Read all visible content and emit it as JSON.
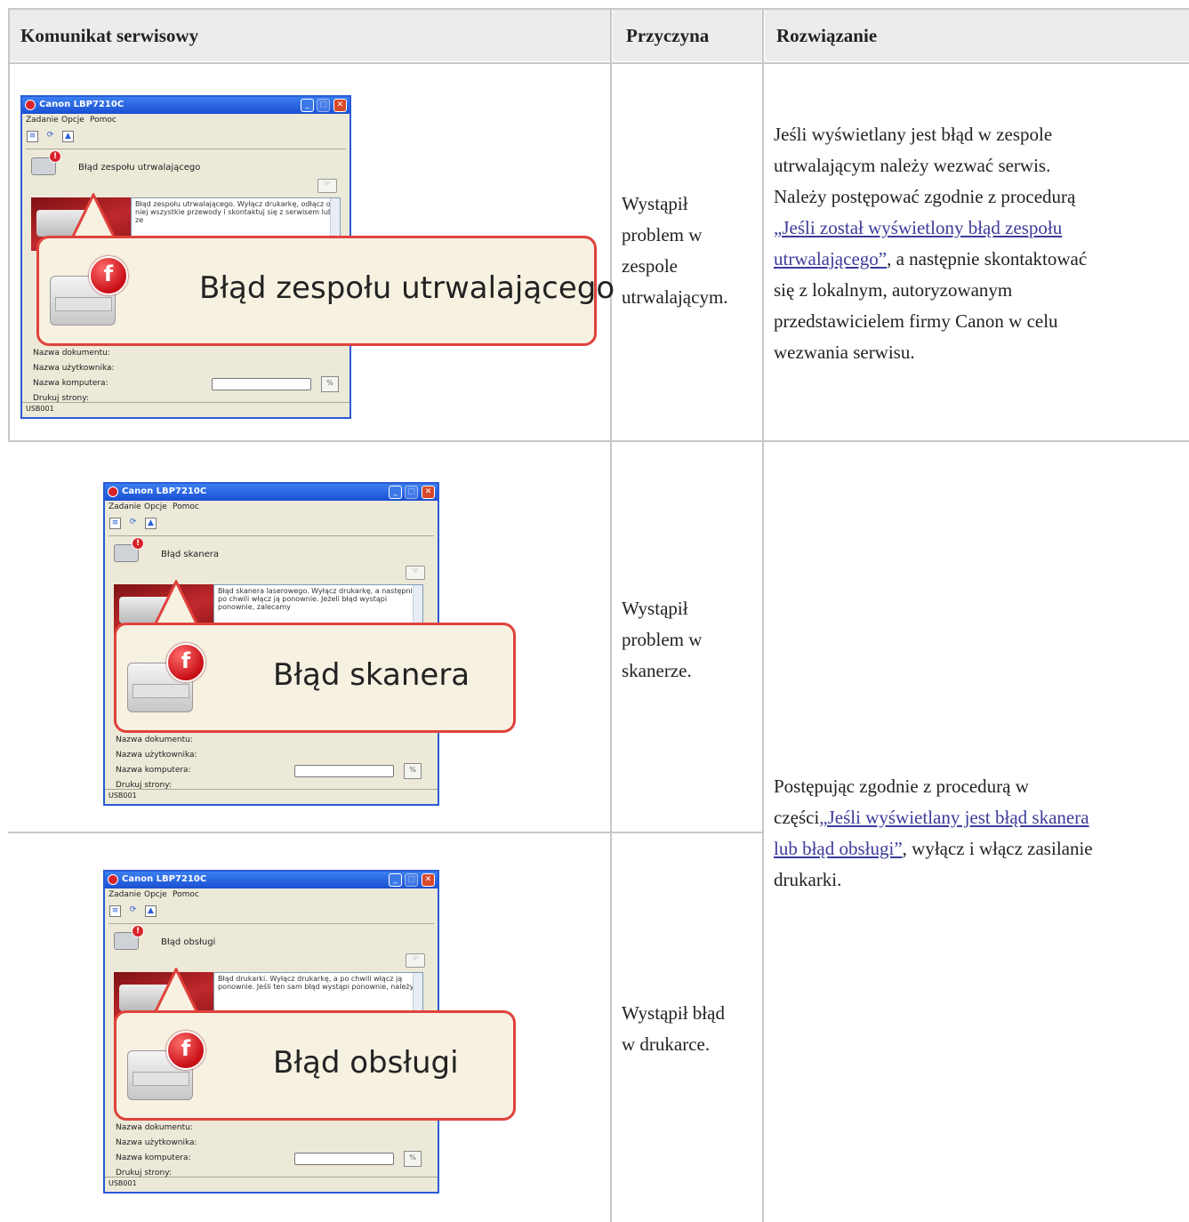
{
  "headers": {
    "message": "Komunikat serwisowy",
    "cause": "Przyczyna",
    "solution": "Rozwiązanie"
  },
  "window": {
    "title": "Canon LBP7210C",
    "menu": [
      "Zadanie",
      "Opcje",
      "Pomoc"
    ],
    "fields": [
      "Nazwa dokumentu:",
      "Nazwa użytkownika:",
      "Nazwa komputera:",
      "Drukuj strony:"
    ],
    "status": "USB001",
    "percent": "%"
  },
  "rows": [
    {
      "status_text": "Błąd zespołu utrwalającego",
      "detail_text": "Błąd zespołu utrwalającego. Wyłącz drukarkę, odłącz od niej wszystkie przewody i skontaktuj się z serwisem lub ze",
      "callout": "Błąd zespołu utrwalającego",
      "cause_lines": [
        "Wystąpił",
        "problem w",
        "zespole",
        "utrwalającym."
      ]
    },
    {
      "status_text": "Błąd skanera",
      "detail_text": "Błąd skanera laserowego. Wyłącz drukarkę, a następnie po chwili włącz ją ponownie. Jeżeli błąd wystąpi ponownie, zalecamy",
      "callout": "Błąd skanera",
      "cause_lines": [
        "Wystąpił",
        "problem w",
        "skanerze."
      ]
    },
    {
      "status_text": "Błąd obsługi",
      "detail_text": "Błąd drukarki. Wyłącz drukarkę, a po chwili włącz ją ponownie. Jeśli ten sam błąd wystąpi ponownie, należy",
      "callout": "Błąd obsługi",
      "cause_lines": [
        "Wystąpił błąd",
        "w drukarce."
      ]
    }
  ],
  "solution1": {
    "lines_before": [
      "Jeśli wyświetlany jest błąd w zespole",
      "utrwalającym należy wezwać serwis.",
      "Należy postępować zgodnie z procedurą"
    ],
    "link_line1": "„Jeśli został wyświetlony błąd zespołu",
    "link_line2": "utrwalającego”",
    "after_link": ", a następnie skontaktować",
    "lines_after": [
      "się z lokalnym, autoryzowanym",
      "przedstawicielem firmy Canon w celu",
      "wezwania serwisu."
    ]
  },
  "solution2": {
    "line1": "Postępując zgodnie z procedurą w",
    "prefix": "części",
    "link_line1": "„Jeśli wyświetlany jest błąd skanera",
    "link_line2": "lub błąd obsługi”",
    "after_link": ", wyłącz i włącz zasilanie",
    "line4": "drukarki."
  }
}
